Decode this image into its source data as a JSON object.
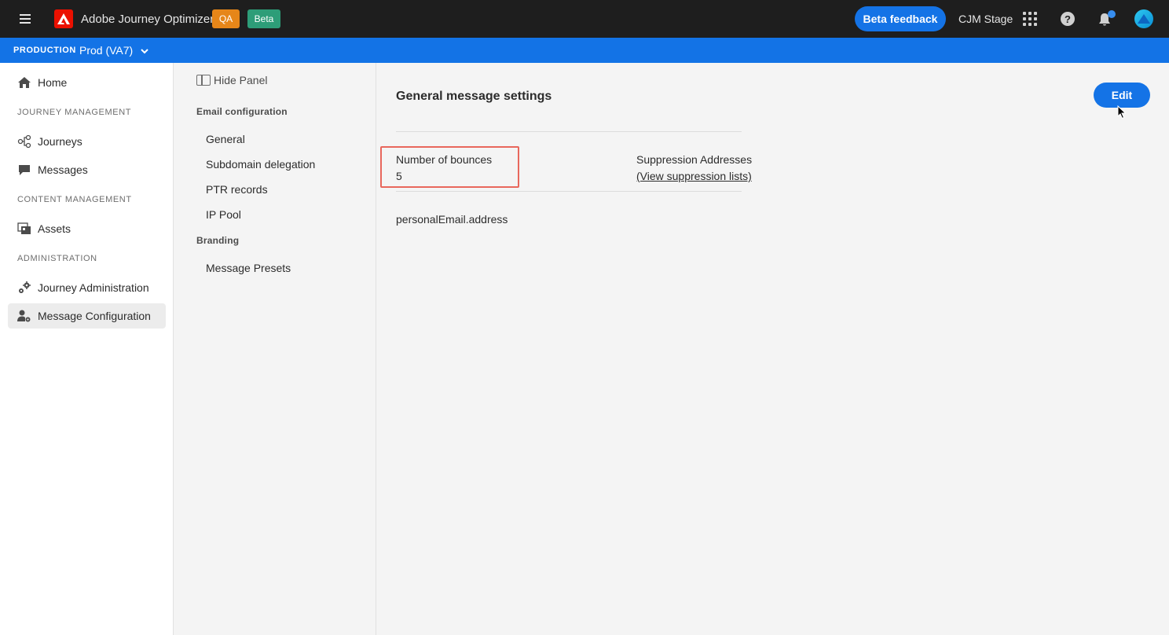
{
  "topbar": {
    "app_title": "Adobe Journey Optimizer",
    "badge_qa": "QA",
    "badge_beta": "Beta",
    "feedback_label": "Beta feedback",
    "org_name": "CJM Stage",
    "colors": {
      "bar": "#1e1e1e",
      "accent": "#1473e6",
      "qa": "#e68619",
      "beta": "#2d9d78"
    }
  },
  "sandbox": {
    "label": "PRODUCTION",
    "name": "Prod (VA7)"
  },
  "leftnav": {
    "home": "Home",
    "section_journey": "JOURNEY MANAGEMENT",
    "journeys": "Journeys",
    "messages": "Messages",
    "section_content": "CONTENT MANAGEMENT",
    "assets": "Assets",
    "section_admin": "ADMINISTRATION",
    "journey_admin": "Journey Administration",
    "message_config": "Message Configuration"
  },
  "midpanel": {
    "hide_panel": "Hide Panel",
    "section_email": "Email configuration",
    "items_email": [
      "General",
      "Subdomain delegation",
      "PTR records",
      "IP Pool"
    ],
    "section_branding": "Branding",
    "items_branding": [
      "Message Presets"
    ]
  },
  "main": {
    "title": "General message settings",
    "edit_label": "Edit",
    "bounces_label": "Number of bounces",
    "bounces_value": "5",
    "suppression_label": "Suppression Addresses",
    "suppression_link": "(View suppression lists)",
    "email_field": "personalEmail.address"
  }
}
